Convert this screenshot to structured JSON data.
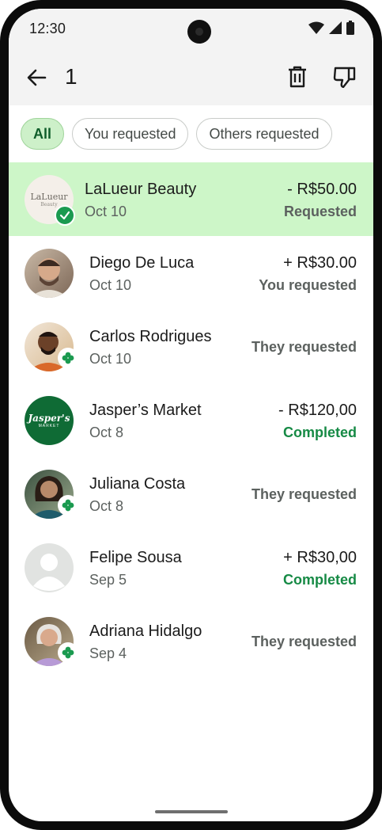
{
  "status_bar": {
    "time": "12:30"
  },
  "app_bar": {
    "selected_count": "1"
  },
  "filters": [
    {
      "label": "All",
      "selected": true
    },
    {
      "label": "You requested",
      "selected": false
    },
    {
      "label": "Others requested",
      "selected": false
    }
  ],
  "transactions": [
    {
      "name": "LaLueur Beauty",
      "date": "Oct 10",
      "amount": "- R$50.00",
      "status": "Requested",
      "logo_text": "LaLueur",
      "logo_sub": "Beauty"
    },
    {
      "name": "Diego De Luca",
      "date": "Oct 10",
      "amount": "+ R$30.00",
      "status": "You requested"
    },
    {
      "name": "Carlos Rodrigues",
      "date": "Oct 10",
      "amount": "",
      "status": "They requested"
    },
    {
      "name": "Jasper’s Market",
      "date": "Oct 8",
      "amount": "- R$120,00",
      "status": "Completed",
      "logo_text": "Jasper's",
      "logo_sub": "MARKET"
    },
    {
      "name": "Juliana Costa",
      "date": "Oct 8",
      "amount": "",
      "status": "They requested"
    },
    {
      "name": "Felipe Sousa",
      "date": "Sep 5",
      "amount": "+ R$30,00",
      "status": "Completed"
    },
    {
      "name": "Adriana Hidalgo",
      "date": "Sep 4",
      "amount": "",
      "status": "They requested"
    }
  ],
  "colors": {
    "selected_row": "#cdf6c8",
    "completed": "#168a45",
    "chip_selected": "#cdf0c9",
    "badge_green": "#1b9a50"
  }
}
